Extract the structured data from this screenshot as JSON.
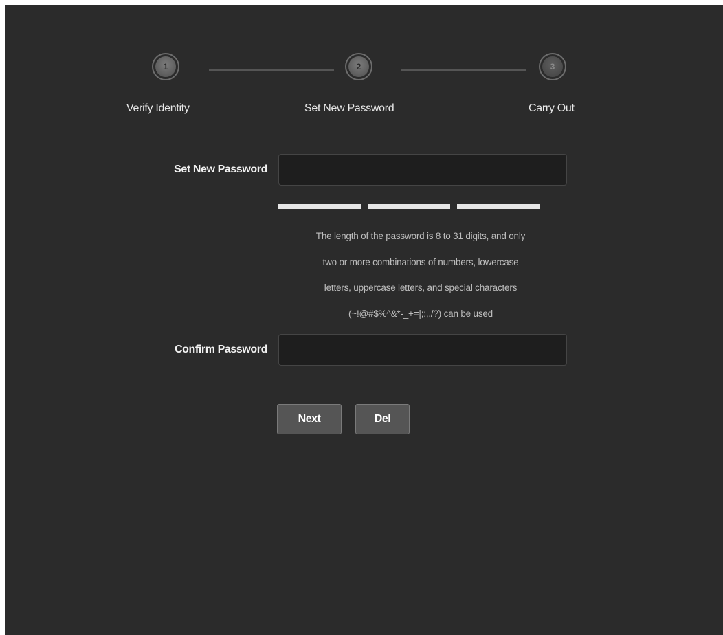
{
  "stepper": {
    "steps": [
      {
        "number": "1",
        "label": "Verify Identity",
        "state": "done"
      },
      {
        "number": "2",
        "label": "Set New Password",
        "state": "current"
      },
      {
        "number": "3",
        "label": "Carry Out",
        "state": "pending"
      }
    ]
  },
  "form": {
    "new_password": {
      "label": "Set New Password",
      "value": "",
      "placeholder": ""
    },
    "strength_meter": {
      "segments": 3,
      "filled_segments": 0
    },
    "hint_lines": [
      "The length of the password is 8 to 31 digits, and only",
      "two or more combinations of numbers, lowercase",
      "letters, uppercase letters, and special characters",
      "(~!@#$%^&*-_+=|;:,./?) can be used"
    ],
    "confirm_password": {
      "label": "Confirm Password",
      "value": "",
      "placeholder": ""
    }
  },
  "actions": {
    "next_label": "Next",
    "del_label": "Del"
  },
  "colors": {
    "background": "#2b2b2b",
    "input_background": "#1e1e1e",
    "button_background": "#555555",
    "text": "#f2f2f2"
  }
}
